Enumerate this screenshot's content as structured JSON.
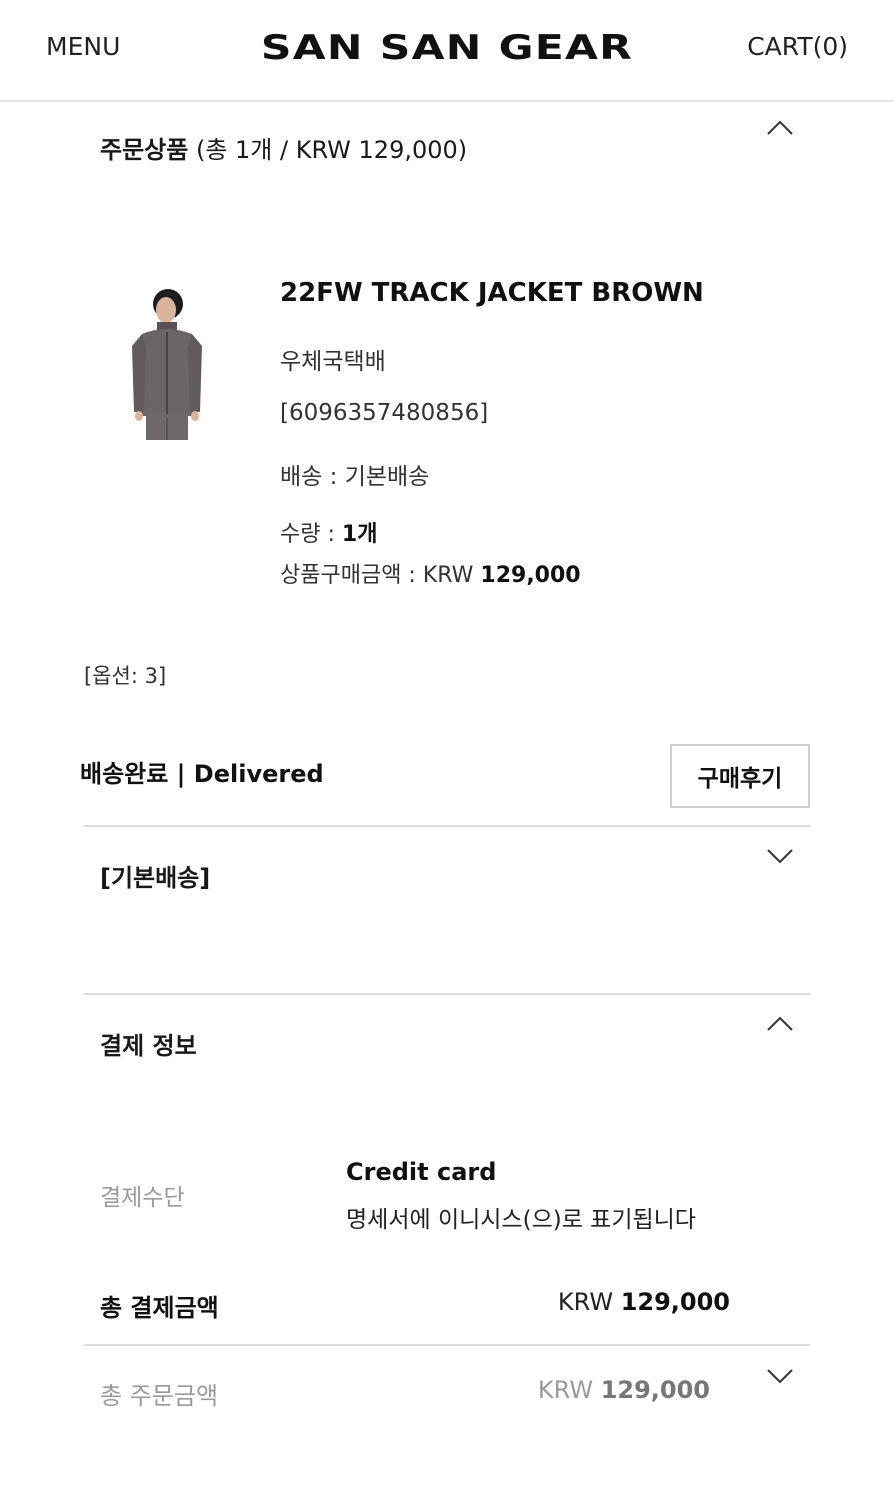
{
  "header": {
    "menu_label": "MENU",
    "brand": "SAN SAN GEAR",
    "cart_label": "CART(0)"
  },
  "order_items": {
    "title": "주문상품",
    "summary": "(총 1개 / KRW 129,000)",
    "product": {
      "name": "22FW TRACK JACKET BROWN",
      "carrier": "우체국택배",
      "tracking": "[6096357480856]",
      "shipping": "배송 : 기본배송",
      "quantity_label": "수량 : ",
      "quantity_value": "1개",
      "price_label": "상품구매금액 : KRW ",
      "price_value": "129,000"
    },
    "option": "[옵션: 3]",
    "status": "배송완료 | Delivered",
    "review_button": "구매후기"
  },
  "basic_shipping": {
    "title": "[기본배송]"
  },
  "payment": {
    "title": "결제 정보",
    "method_label": "결제수단",
    "method_value": "Credit card",
    "method_note": "명세서에 이니시스(으)로 표기됩니다",
    "total_label": "총 결제금액",
    "total_currency": "KRW ",
    "total_value": "129,000",
    "order_total_label": "총 주문금액",
    "order_total_currency": "KRW ",
    "order_total_value": "129,000"
  },
  "icons": {
    "collapse": "chevron-up-icon",
    "expand": "chevron-down-icon"
  },
  "colors": {
    "text": "#1a1a1a",
    "muted": "#9a9a9a",
    "divider": "#dcdcdc"
  }
}
